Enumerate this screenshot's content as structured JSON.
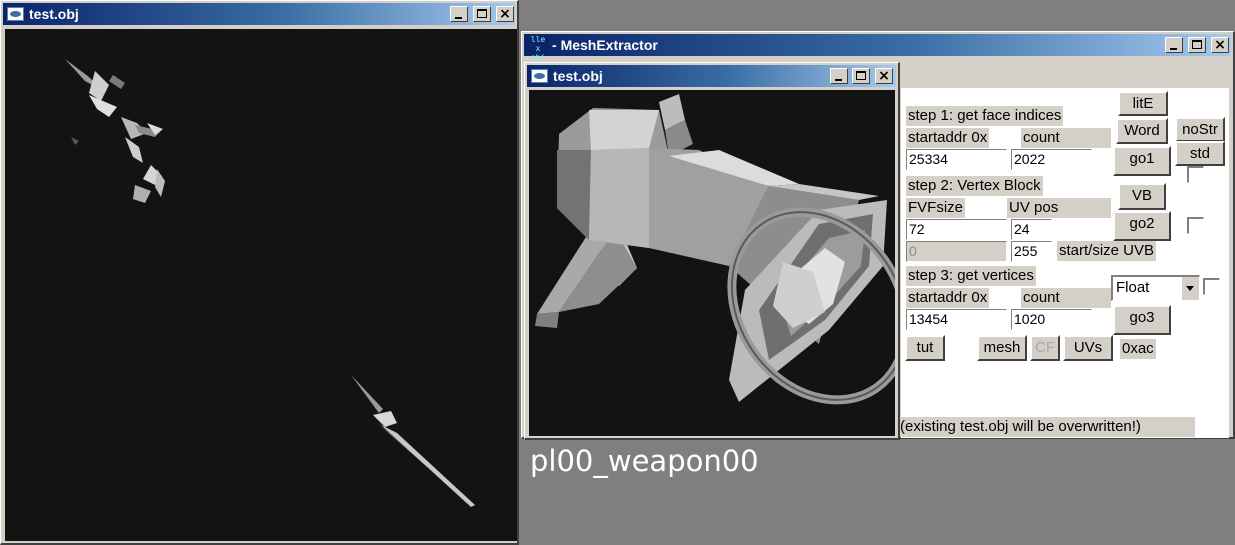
{
  "left_window": {
    "title": "test.obj"
  },
  "main_window": {
    "title": "MeshExtractor",
    "icon_text": [
      "lle x",
      "obj"
    ]
  },
  "preview_window": {
    "title": "test.obj"
  },
  "step1": {
    "heading": "step 1: get face indices",
    "col1_label": "startaddr 0x",
    "col2_label": "count",
    "startaddr": "25334",
    "count": "2022",
    "go_label": "go1"
  },
  "step2": {
    "heading": "step 2: Vertex Block",
    "col1_label": "FVFsize",
    "col2_label": "UV pos",
    "fvfsize": "72",
    "uvpos": "24",
    "uvb_start": "0",
    "uvb_size": "255",
    "uvb_label": "start/size UVB",
    "vb_label": "VB",
    "go_label": "go2"
  },
  "step3": {
    "heading": "step 3: get vertices",
    "col1_label": "startaddr 0x",
    "col2_label": "count",
    "startaddr": "13454",
    "count": "1020",
    "format_selected": "Float",
    "go_label": "go3"
  },
  "buttons": {
    "lite": "litE",
    "word": "Word",
    "nostr": "noStr",
    "std": "std",
    "tut": "tut",
    "mesh": "mesh",
    "cf": "CF",
    "uvs": "UVs"
  },
  "hex_readout": "0xac",
  "status": "(existing test.obj will be overwritten!)",
  "caption": "pl00_weapon00",
  "colors": {
    "title_active": "#0a246a",
    "face": "#d4d0c8",
    "viewport": "#131313"
  }
}
